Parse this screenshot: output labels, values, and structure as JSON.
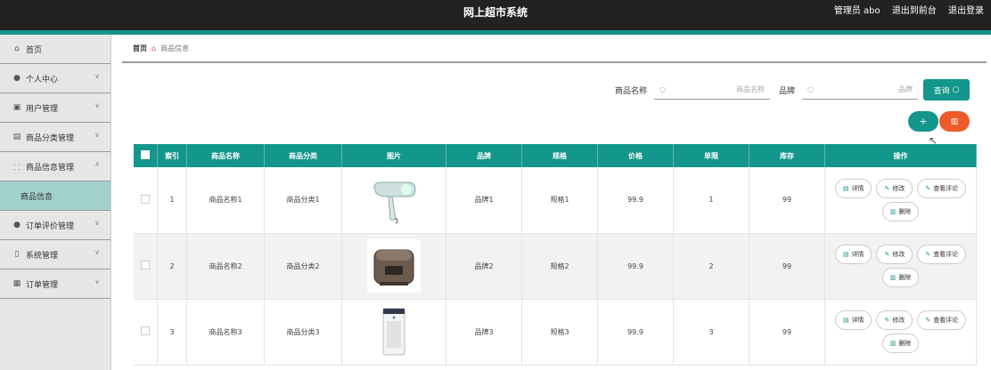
{
  "header": {
    "title": "网上超市系统",
    "admin_label": "管理员 abo",
    "back_front": "退出到前台",
    "logout": "退出登录"
  },
  "sidebar": {
    "items": [
      {
        "label": "首页",
        "icon": "home-icon"
      },
      {
        "label": "个人中心",
        "icon": "user-icon"
      },
      {
        "label": "用户管理",
        "icon": "users-icon"
      },
      {
        "label": "商品分类管理",
        "icon": "category-icon"
      },
      {
        "label": "商品信息管理",
        "icon": "product-icon"
      },
      {
        "label": "商品信息",
        "sub": true
      },
      {
        "label": "订单评价管理",
        "icon": "review-icon"
      },
      {
        "label": "系统管理",
        "icon": "system-icon"
      },
      {
        "label": "订单管理",
        "icon": "order-icon"
      }
    ]
  },
  "breadcrumb": {
    "home": "首页",
    "current": "商品信息"
  },
  "search": {
    "name_label": "商品名称",
    "name_placeholder": "商品名称",
    "brand_label": "品牌",
    "brand_placeholder": "品牌",
    "button": "查询"
  },
  "table": {
    "headers": [
      "索引",
      "商品名称",
      "商品分类",
      "图片",
      "品牌",
      "规格",
      "价格",
      "单限",
      "库存",
      "操作"
    ],
    "rows": [
      {
        "index": "1",
        "name": "商品名称1",
        "category": "商品分类1",
        "image": "hair-dryer",
        "brand": "品牌1",
        "spec": "规格1",
        "price": "99.9",
        "limit": "1",
        "stock": "99"
      },
      {
        "index": "2",
        "name": "商品名称2",
        "category": "商品分类2",
        "image": "rice-cooker",
        "brand": "品牌2",
        "spec": "规格2",
        "price": "99.9",
        "limit": "2",
        "stock": "99"
      },
      {
        "index": "3",
        "name": "商品名称3",
        "category": "商品分类3",
        "image": "air-purifier",
        "brand": "品牌3",
        "spec": "规格3",
        "price": "99.9",
        "limit": "3",
        "stock": "99"
      }
    ],
    "ops": {
      "detail": "详情",
      "edit": "修改",
      "review": "查看评论",
      "delete": "删除"
    }
  },
  "colors": {
    "accent": "#13968b",
    "danger": "#ef5a2a",
    "topbar": "#222222"
  }
}
